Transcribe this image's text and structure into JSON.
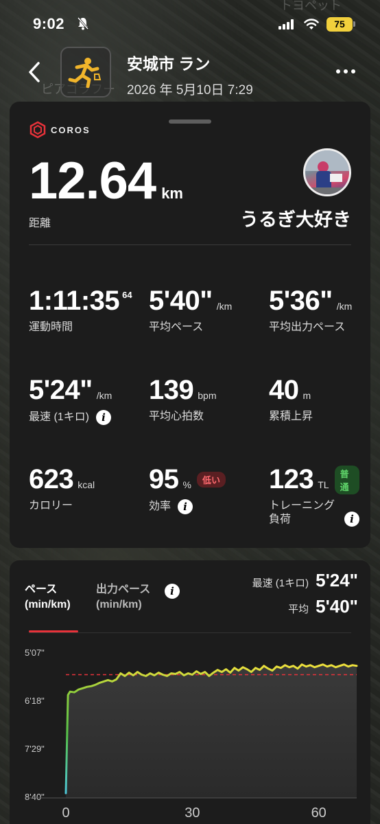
{
  "status_bar": {
    "time": "9:02",
    "battery": "75"
  },
  "map_labels": [
    "トヨペット",
    "ピアゴラフー"
  ],
  "header": {
    "title": "安城市 ラン",
    "datetime": "2026 年 5月10日 7:29"
  },
  "summary": {
    "brand": "COROS",
    "distance": "12.64",
    "distance_unit": "km",
    "distance_label": "距離",
    "username": "うるぎ大好き"
  },
  "stats": {
    "time": {
      "value": "1:11:35",
      "sup": "64",
      "label": "運動時間"
    },
    "avg_pace": {
      "value": "5'40\"",
      "unit": "/km",
      "label": "平均ペース"
    },
    "avg_power_pace": {
      "value": "5'36\"",
      "unit": "/km",
      "label": "平均出力ペース"
    },
    "fastest": {
      "value": "5'24\"",
      "unit": "/km",
      "label": "最速 (1キロ)"
    },
    "avg_hr": {
      "value": "139",
      "unit": "bpm",
      "label": "平均心拍数"
    },
    "ascent": {
      "value": "40",
      "unit": "m",
      "label": "累積上昇"
    },
    "calories": {
      "value": "623",
      "unit": "kcal",
      "label": "カロリー"
    },
    "efficiency": {
      "value": "95",
      "unit": "%",
      "badge": "低い",
      "label": "効率"
    },
    "training_load": {
      "value": "123",
      "unit": "TL",
      "badge": "普通",
      "label_line1": "トレーニング",
      "label_line2": "負荷"
    }
  },
  "pace_panel": {
    "tab_pace": [
      "ペース",
      "(min/km)"
    ],
    "tab_power_pace": [
      "出力ペース",
      "(min/km)"
    ],
    "fastest_label": "最速 (1キロ)",
    "fastest_value": "5'24\"",
    "avg_label": "平均",
    "avg_value": "5'40\""
  },
  "chart_data": {
    "type": "line",
    "title": "",
    "xlabel": "",
    "ylabel": "",
    "y_ticks": [
      "5'07\"",
      "6'18\"",
      "7'29\"",
      "8'40\""
    ],
    "x_ticks": [
      "0",
      "30",
      "60"
    ],
    "xlim": [
      0,
      69
    ],
    "ylim_sec_per_km": [
      307,
      520
    ],
    "y_inverted": true,
    "avg_line_sec_per_km": 340,
    "series": [
      {
        "x": [
          0,
          0.5,
          1,
          2,
          3,
          4,
          5,
          6,
          7,
          8,
          9,
          10,
          11,
          12,
          13,
          14,
          15,
          16,
          17,
          18,
          19,
          20,
          21,
          22,
          23,
          24,
          25,
          26,
          27,
          28,
          29,
          30,
          31,
          32,
          33,
          34,
          35,
          36,
          37,
          38,
          39,
          40,
          41,
          42,
          43,
          44,
          45,
          46,
          47,
          48,
          49,
          50,
          51,
          52,
          53,
          54,
          55,
          56,
          57,
          58,
          59,
          60,
          61,
          62,
          63,
          64,
          65,
          66,
          67,
          68,
          69
        ],
        "y": [
          515,
          370,
          365,
          366,
          362,
          360,
          358,
          357,
          355,
          352,
          350,
          348,
          350,
          347,
          338,
          342,
          337,
          341,
          336,
          340,
          342,
          338,
          341,
          337,
          340,
          342,
          338,
          339,
          336,
          341,
          338,
          340,
          335,
          339,
          336,
          342,
          337,
          333,
          336,
          332,
          337,
          330,
          334,
          329,
          332,
          336,
          330,
          333,
          327,
          331,
          334,
          328,
          330,
          326,
          329,
          327,
          331,
          325,
          328,
          326,
          329,
          327,
          325,
          328,
          326,
          329,
          327,
          325,
          328,
          326,
          327
        ]
      }
    ]
  }
}
